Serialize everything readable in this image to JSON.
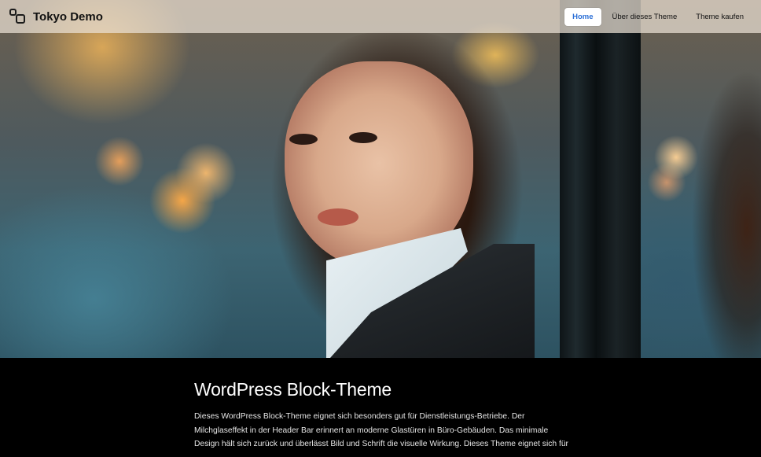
{
  "header": {
    "site_title": "Tokyo Demo",
    "logo_icon": "two-squares-logo-icon",
    "nav": [
      {
        "label": "Home",
        "active": true
      },
      {
        "label": "Über dieses Theme",
        "active": false
      },
      {
        "label": "Theme kaufen",
        "active": false
      }
    ],
    "accent_color": "#2b6fd6"
  },
  "hero": {
    "description_kind": "photo"
  },
  "content": {
    "heading": "WordPress Block-Theme",
    "paragraph": "Dieses WordPress Block-Theme eignet sich besonders gut für Dienstleistungs-Betriebe. Der Milchglaseffekt in der Header Bar erinnert an moderne Glastüren in Büro-Gebäuden. Das minimale Design hält sich zurück und überlässt Bild und Schrift die visuelle Wirkung. Dieses Theme eignet sich für"
  }
}
